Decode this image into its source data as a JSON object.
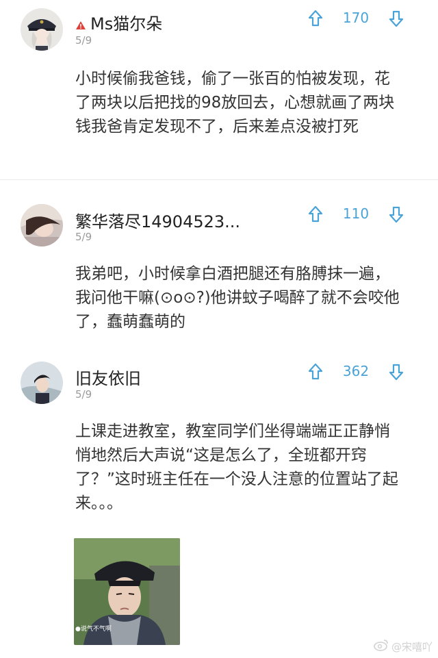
{
  "comments": [
    {
      "username": "Ms猫尔朵",
      "date": "5/9",
      "votes": "170",
      "text": "小时候偷我爸钱，偷了一张百的怕被发现，花了两块以后把找的98放回去，心想就画了两块钱我爸肯定发现不了，后来差点没被打死"
    },
    {
      "username": "繁华落尽14904523...",
      "date": "5/9",
      "votes": "110",
      "text": "我弟吧，小时候拿白酒把腿还有胳膊抹一遍，我问他干嘛(⊙o⊙?)他讲蚊子喝醉了就不会咬他了，蠢萌蠢萌的"
    },
    {
      "username": "旧友依旧",
      "date": "5/9",
      "votes": "362",
      "text": "上课走进教室，教室同学们坐得端端正正静悄悄地然后大声说“这是怎么了，全班都开窍了？”这时班主任在一个没人注意的位置站了起来。。。"
    }
  ],
  "photo": {
    "caption": "●说气不气啊"
  },
  "watermark": {
    "text": "@宋嘻吖"
  },
  "colors": {
    "accent": "#4aa3d8",
    "badge": "#e0403a",
    "date": "#9a9a9a"
  }
}
